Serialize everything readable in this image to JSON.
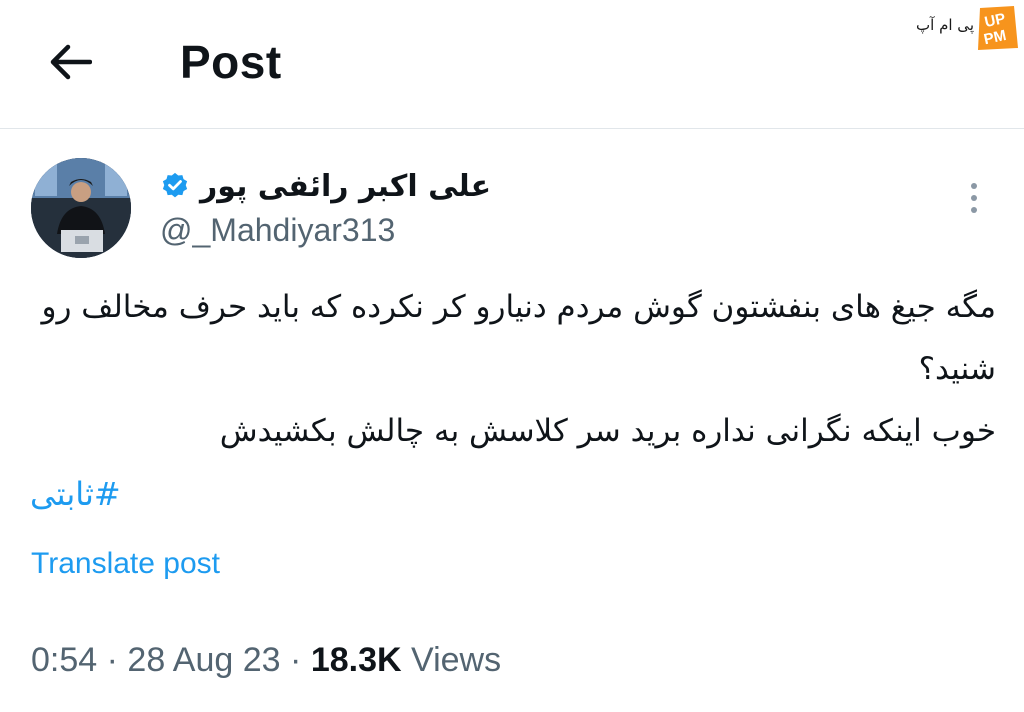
{
  "header": {
    "title": "Post",
    "back_icon": "arrow-left-icon"
  },
  "watermark": {
    "text": "پی ام آپ",
    "logo_text": "PMUP",
    "logo_color": "#f7941d"
  },
  "post": {
    "author": {
      "display_name": "علی اکبر رائفی پور",
      "handle": "@_Mahdiyar313",
      "verified": true,
      "verified_color": "#1d9bf0"
    },
    "body_lines": [
      "مگه جیغ های بنفشتون گوش مردم دنیارو کر نکرده که باید حرف مخالف رو شنید؟",
      "خوب اینکه نگرانی نداره برید سر کلاسش به چالش بکشیدش"
    ],
    "hashtag": "ثابتی#",
    "translate_label": "Translate post",
    "time": "0:54",
    "date": "28 Aug 23",
    "views_count": "18.3K",
    "views_label": "Views",
    "separator": "·"
  },
  "colors": {
    "accent": "#1d9bf0",
    "muted": "#536471",
    "text": "#0f1419",
    "divider": "#e1e6ea"
  }
}
